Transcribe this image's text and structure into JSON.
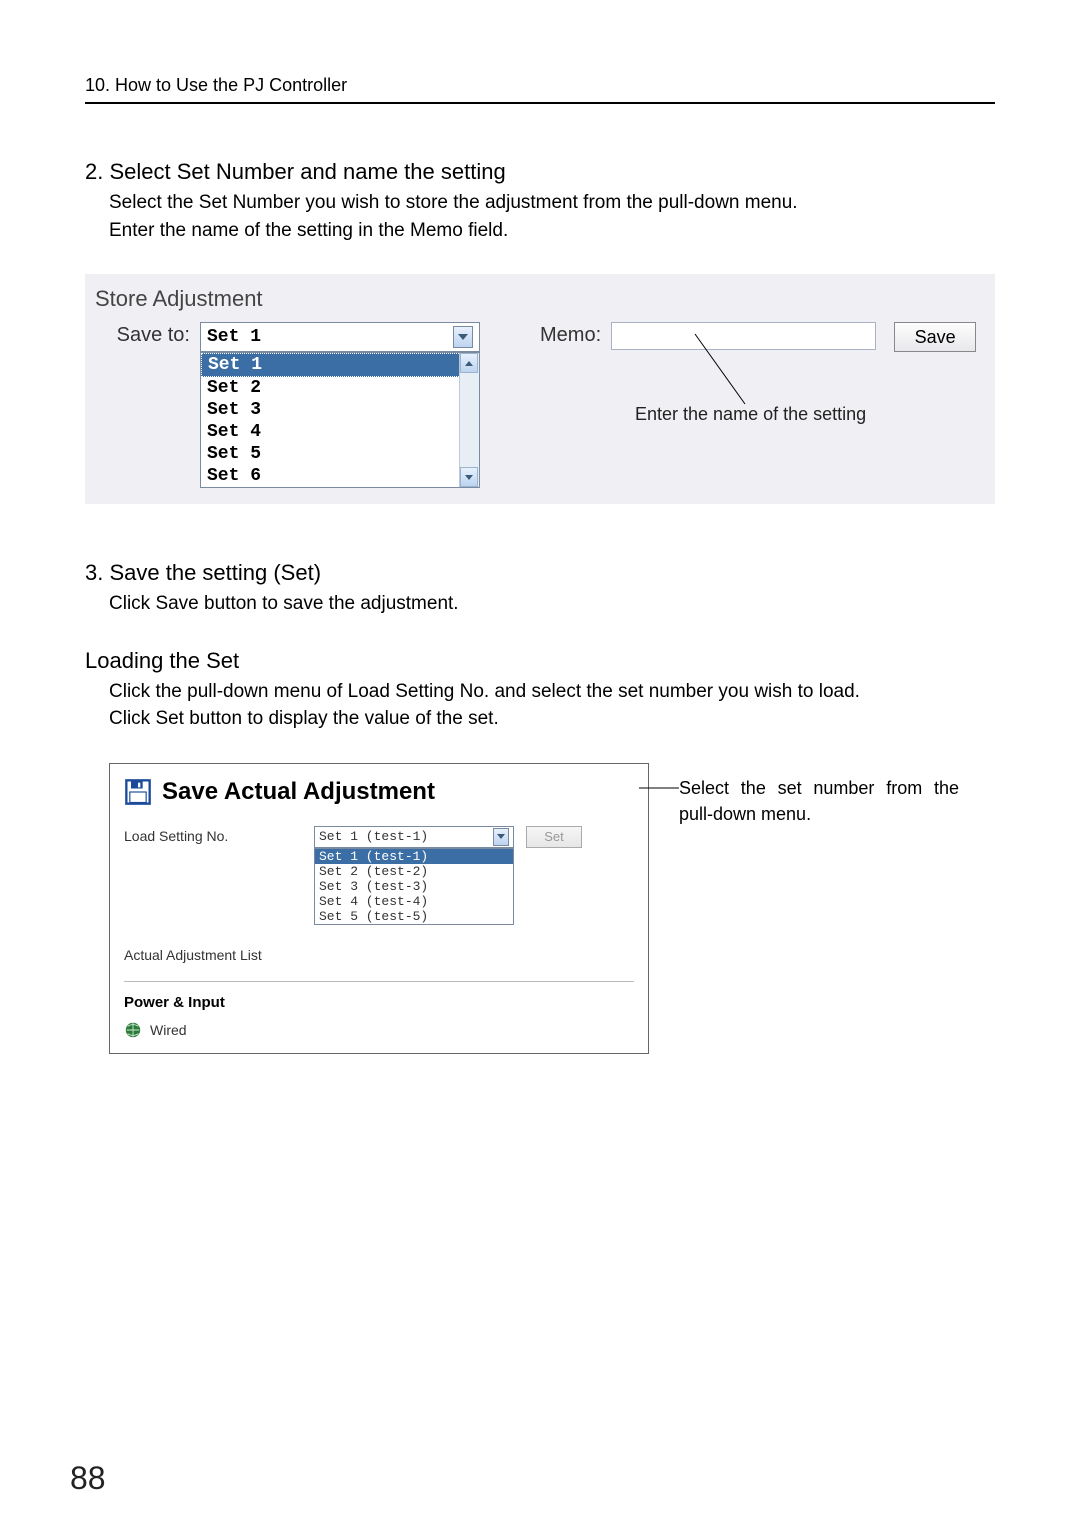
{
  "header": "10. How to Use the PJ Controller",
  "step2": {
    "heading": "2. Select Set Number and name the setting",
    "body1": "Select the Set Number you wish to store the adjustment from the pull-down menu.",
    "body2": "Enter the name of the setting in the Memo field."
  },
  "store_panel": {
    "title": "Store Adjustment",
    "save_to_label": "Save to:",
    "selected": "Set 1",
    "options": [
      "Set 1",
      "Set 2",
      "Set 3",
      "Set 4",
      "Set 5",
      "Set 6"
    ],
    "memo_label": "Memo:",
    "save_btn": "Save",
    "callout": "Enter the name of the setting"
  },
  "step3": {
    "heading": "3. Save the setting (Set)",
    "body": "Click Save button to save the adjustment."
  },
  "loading": {
    "heading": "Loading the Set",
    "body1": "Click the pull-down menu of Load Setting No. and select the set number you wish to load.",
    "body2": "Click Set button to display the value of the set."
  },
  "panel2": {
    "title": "Save Actual Adjustment",
    "load_label": "Load Setting No.",
    "load_selected": "Set 1 (test-1)",
    "load_options": [
      "Set 1 (test-1)",
      "Set 2 (test-2)",
      "Set 3 (test-3)",
      "Set 4 (test-4)",
      "Set 5 (test-5)"
    ],
    "list_label": "Actual Adjustment List",
    "set_btn": "Set",
    "pi_title": "Power & Input",
    "wired": "Wired"
  },
  "side_note": "Select the set number from the pull-down menu.",
  "page_number": "88"
}
